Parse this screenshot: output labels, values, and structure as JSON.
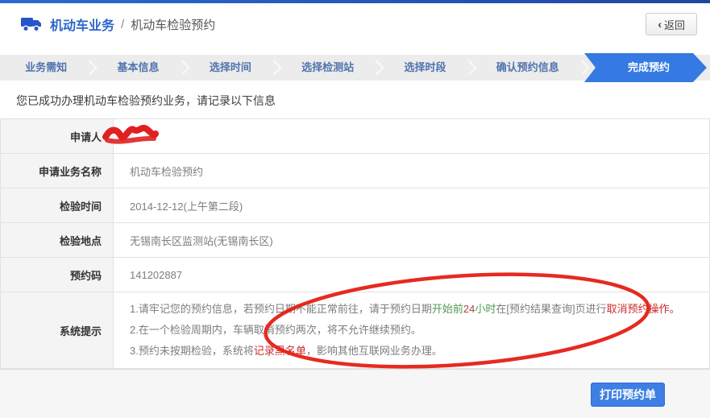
{
  "header": {
    "truck_icon": "truck-icon",
    "breadcrumb_root": "机动车业务",
    "breadcrumb_separator": "/",
    "breadcrumb_current": "机动车检验预约",
    "back_chevron": "‹",
    "back_label": "返回"
  },
  "steps": {
    "items": [
      "业务需知",
      "基本信息",
      "选择时间",
      "选择检测站",
      "选择时段",
      "确认预约信息",
      "完成预约"
    ],
    "active_label": "完成预约",
    "active_index": 6
  },
  "main": {
    "success_message": "您已成功办理机动车检验预约业务，请记录以下信息"
  },
  "table": {
    "rows": [
      {
        "label": "申请人",
        "value": ""
      },
      {
        "label": "申请业务名称",
        "value": "机动车检验预约"
      },
      {
        "label": "检验时间",
        "value": "2014-12-12(上午第二段)"
      },
      {
        "label": "检验地点",
        "value": "无锡南长区监测站(无锡南长区)"
      },
      {
        "label": "预约码",
        "value": "141202887"
      }
    ],
    "system_tips": {
      "label": "系统提示",
      "lines": [
        {
          "segments": [
            {
              "text": "1.请牢记您的预约信息，若预约日期不能正常前往，请于预约日期",
              "color": "default"
            },
            {
              "text": "开始前",
              "color": "green"
            },
            {
              "text": "24",
              "color": "darkred"
            },
            {
              "text": "小时",
              "color": "green"
            },
            {
              "text": "在[预约结果查询]页进行",
              "color": "default"
            },
            {
              "text": "取消预约操作。",
              "color": "red"
            }
          ]
        },
        {
          "segments": [
            {
              "text": "2.在一个检验周期内，车辆取消预约两次，将不允许继续预约。",
              "color": "default"
            }
          ]
        },
        {
          "segments": [
            {
              "text": "3.预约未按期检验，系统将",
              "color": "default"
            },
            {
              "text": "记录黑名单",
              "color": "red"
            },
            {
              "text": "，影响其他互联网业务办理。",
              "color": "default"
            }
          ]
        }
      ]
    }
  },
  "footer": {
    "print_button_label": "打印预约单"
  },
  "colors": {
    "accent_blue": "#2b66c9",
    "step_active_blue": "#3579e2",
    "button_blue": "#3d7fe3",
    "annotation_red": "#e51f14",
    "tip_red": "#cc2a2a",
    "tip_green": "#4e9b4e",
    "step_bar_bg": "#ececec",
    "label_cell_bg": "#f4f4f4"
  }
}
